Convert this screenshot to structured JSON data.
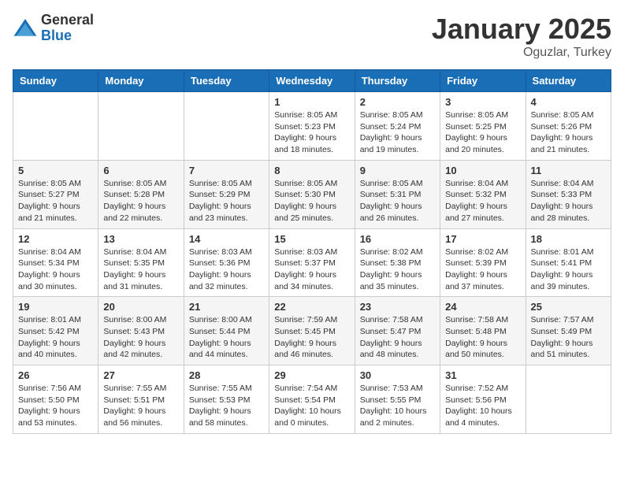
{
  "header": {
    "logo_general": "General",
    "logo_blue": "Blue",
    "month_title": "January 2025",
    "location": "Oguzlar, Turkey"
  },
  "weekdays": [
    "Sunday",
    "Monday",
    "Tuesday",
    "Wednesday",
    "Thursday",
    "Friday",
    "Saturday"
  ],
  "weeks": [
    [
      {
        "day": "",
        "info": ""
      },
      {
        "day": "",
        "info": ""
      },
      {
        "day": "",
        "info": ""
      },
      {
        "day": "1",
        "info": "Sunrise: 8:05 AM\nSunset: 5:23 PM\nDaylight: 9 hours\nand 18 minutes."
      },
      {
        "day": "2",
        "info": "Sunrise: 8:05 AM\nSunset: 5:24 PM\nDaylight: 9 hours\nand 19 minutes."
      },
      {
        "day": "3",
        "info": "Sunrise: 8:05 AM\nSunset: 5:25 PM\nDaylight: 9 hours\nand 20 minutes."
      },
      {
        "day": "4",
        "info": "Sunrise: 8:05 AM\nSunset: 5:26 PM\nDaylight: 9 hours\nand 21 minutes."
      }
    ],
    [
      {
        "day": "5",
        "info": "Sunrise: 8:05 AM\nSunset: 5:27 PM\nDaylight: 9 hours\nand 21 minutes."
      },
      {
        "day": "6",
        "info": "Sunrise: 8:05 AM\nSunset: 5:28 PM\nDaylight: 9 hours\nand 22 minutes."
      },
      {
        "day": "7",
        "info": "Sunrise: 8:05 AM\nSunset: 5:29 PM\nDaylight: 9 hours\nand 23 minutes."
      },
      {
        "day": "8",
        "info": "Sunrise: 8:05 AM\nSunset: 5:30 PM\nDaylight: 9 hours\nand 25 minutes."
      },
      {
        "day": "9",
        "info": "Sunrise: 8:05 AM\nSunset: 5:31 PM\nDaylight: 9 hours\nand 26 minutes."
      },
      {
        "day": "10",
        "info": "Sunrise: 8:04 AM\nSunset: 5:32 PM\nDaylight: 9 hours\nand 27 minutes."
      },
      {
        "day": "11",
        "info": "Sunrise: 8:04 AM\nSunset: 5:33 PM\nDaylight: 9 hours\nand 28 minutes."
      }
    ],
    [
      {
        "day": "12",
        "info": "Sunrise: 8:04 AM\nSunset: 5:34 PM\nDaylight: 9 hours\nand 30 minutes."
      },
      {
        "day": "13",
        "info": "Sunrise: 8:04 AM\nSunset: 5:35 PM\nDaylight: 9 hours\nand 31 minutes."
      },
      {
        "day": "14",
        "info": "Sunrise: 8:03 AM\nSunset: 5:36 PM\nDaylight: 9 hours\nand 32 minutes."
      },
      {
        "day": "15",
        "info": "Sunrise: 8:03 AM\nSunset: 5:37 PM\nDaylight: 9 hours\nand 34 minutes."
      },
      {
        "day": "16",
        "info": "Sunrise: 8:02 AM\nSunset: 5:38 PM\nDaylight: 9 hours\nand 35 minutes."
      },
      {
        "day": "17",
        "info": "Sunrise: 8:02 AM\nSunset: 5:39 PM\nDaylight: 9 hours\nand 37 minutes."
      },
      {
        "day": "18",
        "info": "Sunrise: 8:01 AM\nSunset: 5:41 PM\nDaylight: 9 hours\nand 39 minutes."
      }
    ],
    [
      {
        "day": "19",
        "info": "Sunrise: 8:01 AM\nSunset: 5:42 PM\nDaylight: 9 hours\nand 40 minutes."
      },
      {
        "day": "20",
        "info": "Sunrise: 8:00 AM\nSunset: 5:43 PM\nDaylight: 9 hours\nand 42 minutes."
      },
      {
        "day": "21",
        "info": "Sunrise: 8:00 AM\nSunset: 5:44 PM\nDaylight: 9 hours\nand 44 minutes."
      },
      {
        "day": "22",
        "info": "Sunrise: 7:59 AM\nSunset: 5:45 PM\nDaylight: 9 hours\nand 46 minutes."
      },
      {
        "day": "23",
        "info": "Sunrise: 7:58 AM\nSunset: 5:47 PM\nDaylight: 9 hours\nand 48 minutes."
      },
      {
        "day": "24",
        "info": "Sunrise: 7:58 AM\nSunset: 5:48 PM\nDaylight: 9 hours\nand 50 minutes."
      },
      {
        "day": "25",
        "info": "Sunrise: 7:57 AM\nSunset: 5:49 PM\nDaylight: 9 hours\nand 51 minutes."
      }
    ],
    [
      {
        "day": "26",
        "info": "Sunrise: 7:56 AM\nSunset: 5:50 PM\nDaylight: 9 hours\nand 53 minutes."
      },
      {
        "day": "27",
        "info": "Sunrise: 7:55 AM\nSunset: 5:51 PM\nDaylight: 9 hours\nand 56 minutes."
      },
      {
        "day": "28",
        "info": "Sunrise: 7:55 AM\nSunset: 5:53 PM\nDaylight: 9 hours\nand 58 minutes."
      },
      {
        "day": "29",
        "info": "Sunrise: 7:54 AM\nSunset: 5:54 PM\nDaylight: 10 hours\nand 0 minutes."
      },
      {
        "day": "30",
        "info": "Sunrise: 7:53 AM\nSunset: 5:55 PM\nDaylight: 10 hours\nand 2 minutes."
      },
      {
        "day": "31",
        "info": "Sunrise: 7:52 AM\nSunset: 5:56 PM\nDaylight: 10 hours\nand 4 minutes."
      },
      {
        "day": "",
        "info": ""
      }
    ]
  ]
}
